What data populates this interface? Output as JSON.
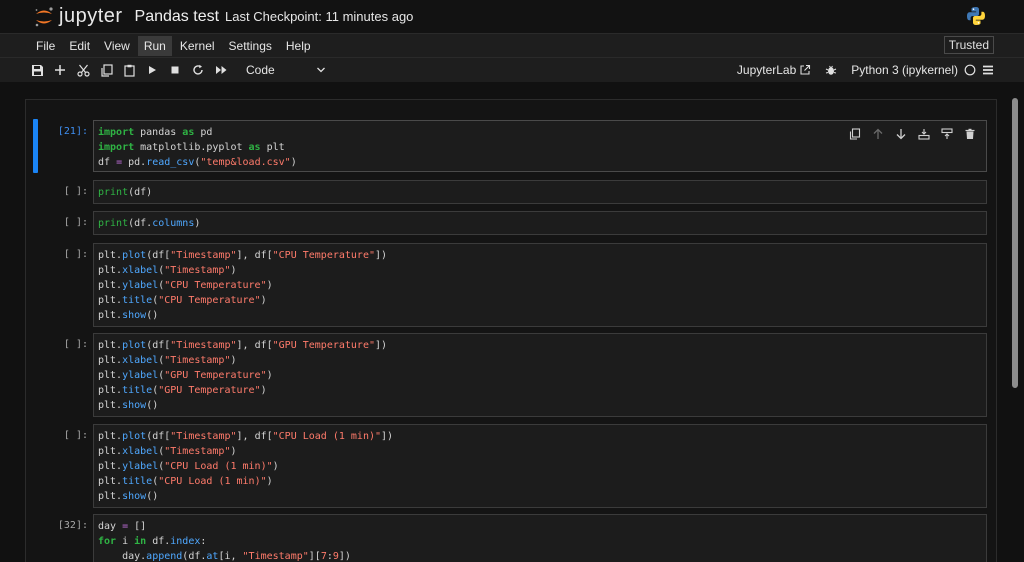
{
  "header": {
    "logo_text": "jupyter",
    "notebook_title": "Pandas test",
    "checkpoint": "Last Checkpoint: 11 minutes ago"
  },
  "menubar": {
    "items": [
      "File",
      "Edit",
      "View",
      "Run",
      "Kernel",
      "Settings",
      "Help"
    ],
    "active": "Run",
    "trusted": "Trusted"
  },
  "toolbar": {
    "cell_type": "Code",
    "jupyterlab_label": "JupyterLab",
    "kernel_label": "Python 3 (ipykernel)"
  },
  "cells": [
    {
      "prompt": "[21]:",
      "lines": [
        "import pandas as pd",
        "import matplotlib.pyplot as plt",
        "df = pd.read_csv(\"temp&load.csv\")"
      ]
    },
    {
      "prompt": "[ ]:",
      "lines": [
        "print(df)"
      ]
    },
    {
      "prompt": "[ ]:",
      "lines": [
        "print(df.columns)"
      ]
    },
    {
      "prompt": "[ ]:",
      "lines": [
        "plt.plot(df[\"Timestamp\"], df[\"CPU Temperature\"])",
        "plt.xlabel(\"Timestamp\")",
        "plt.ylabel(\"CPU Temperature\")",
        "plt.title(\"CPU Temperature\")",
        "plt.show()"
      ]
    },
    {
      "prompt": "[ ]:",
      "lines": [
        "plt.plot(df[\"Timestamp\"], df[\"GPU Temperature\"])",
        "plt.xlabel(\"Timestamp\")",
        "plt.ylabel(\"GPU Temperature\")",
        "plt.title(\"GPU Temperature\")",
        "plt.show()"
      ]
    },
    {
      "prompt": "[ ]:",
      "lines": [
        "plt.plot(df[\"Timestamp\"], df[\"CPU Load (1 min)\"])",
        "plt.xlabel(\"Timestamp\")",
        "plt.ylabel(\"CPU Load (1 min)\")",
        "plt.title(\"CPU Load (1 min)\")",
        "plt.show()"
      ]
    },
    {
      "prompt": "[32]:",
      "lines": [
        "day = []",
        "for i in df.index:",
        "    day.append(df.at[i, \"Timestamp\"][7:9])"
      ]
    }
  ],
  "colors": {
    "accent": "#1a84f5",
    "keyword": "#2fb344",
    "string": "#ff7b6b",
    "attribute": "#4fa8ff",
    "operator": "#c16edc"
  }
}
